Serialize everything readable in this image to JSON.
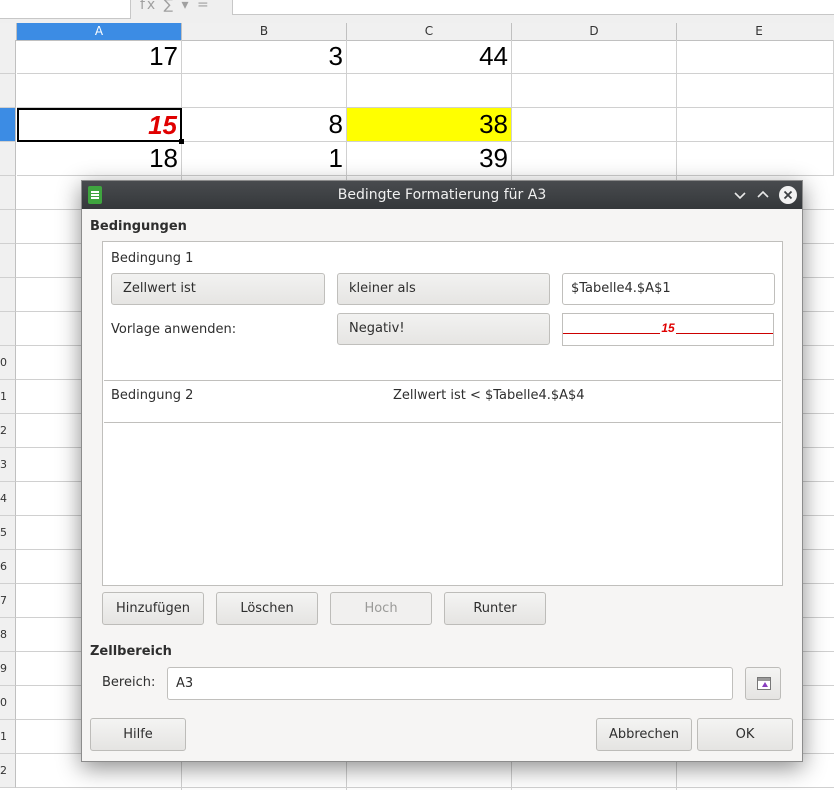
{
  "spreadsheet": {
    "columns": [
      "A",
      "B",
      "C",
      "D",
      "E"
    ],
    "row_numbers": [
      "0",
      "1",
      "2",
      "3",
      "4",
      "5",
      "6",
      "7",
      "8",
      "9",
      "0",
      "1",
      "2"
    ],
    "rows": [
      [
        "17",
        "3",
        "44",
        "",
        ""
      ],
      [
        "",
        "",
        "",
        "",
        ""
      ],
      [
        "15",
        "8",
        "38",
        "",
        ""
      ],
      [
        "18",
        "1",
        "39",
        "",
        ""
      ]
    ],
    "highlight_color": "#ffff00",
    "negative_color": "#e00000",
    "selection_color": "#3c8ce4"
  },
  "toolbar": {
    "formula_icons": "fx ∑ ▾ ="
  },
  "dialog": {
    "title": "Bedingte Formatierung für A3",
    "conditions_heading": "Bedingungen",
    "condition1": {
      "label": "Bedingung 1",
      "type": "Zellwert ist",
      "operator": "kleiner als",
      "value": "$Tabelle4.$A$1",
      "apply_style_label": "Vorlage anwenden:",
      "style": "Negativ!",
      "preview_value": "15"
    },
    "condition2": {
      "label": "Bedingung 2",
      "summary": "Zellwert ist < $Tabelle4.$A$4"
    },
    "buttons": {
      "add": "Hinzufügen",
      "delete": "Löschen",
      "up": "Hoch",
      "down": "Runter",
      "help": "Hilfe",
      "cancel": "Abbrechen",
      "ok": "OK"
    },
    "range_heading": "Zellbereich",
    "range_label": "Bereich:",
    "range_value": "A3"
  }
}
